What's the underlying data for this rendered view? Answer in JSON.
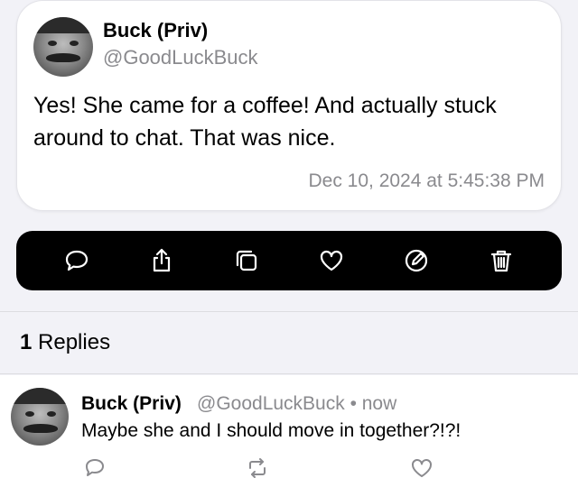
{
  "post": {
    "display_name": "Buck (Priv)",
    "handle": "@GoodLuckBuck",
    "text": "Yes! She came for a coffee! And actually stuck around to chat. That was nice.",
    "timestamp": "Dec 10, 2024 at 5:45:38 PM"
  },
  "toolbar": {
    "icons": [
      "comment-icon",
      "share-icon",
      "copy-icon",
      "heart-icon",
      "edit-icon",
      "trash-icon"
    ]
  },
  "replies_section": {
    "count": "1",
    "label": "Replies"
  },
  "reply": {
    "display_name": "Buck (Priv)",
    "meta": "@GoodLuckBuck • now",
    "text": "Maybe she and I should move in together?!?!",
    "icons": [
      "comment-icon",
      "repost-icon",
      "heart-icon"
    ]
  },
  "colors": {
    "background": "#f2f2f7",
    "toolbar": "#000000",
    "secondary_text": "#8a8a8e"
  }
}
